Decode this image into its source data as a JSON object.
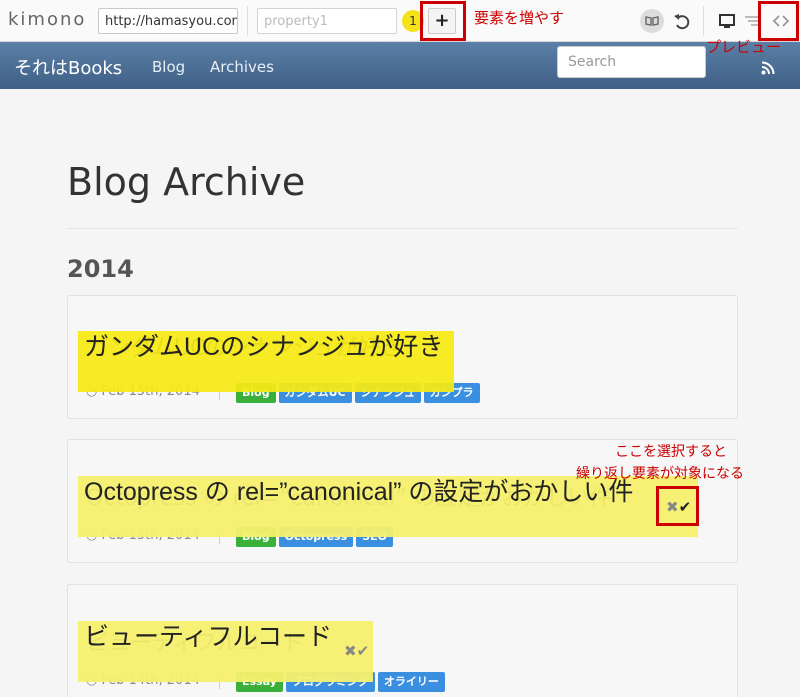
{
  "kimono": {
    "logo": "kimono",
    "url": "http://hamasyou.com/",
    "property_placeholder": "property1",
    "selected_count": "1",
    "add_label": "+",
    "annotation_add": "要素を増やす",
    "annotation_preview": "プレビュー",
    "annotation_select_line1": "ここを選択すると",
    "annotation_select_line2": "繰り返し要素が対象になる"
  },
  "blog": {
    "brand": "それはBooks",
    "nav": [
      "Blog",
      "Archives"
    ],
    "search_placeholder": "Search",
    "page_title": "Blog Archive",
    "year": "2014"
  },
  "posts": [
    {
      "title": "ガンダムUCのシナンジュが好き",
      "date": "Feb 15th, 2014",
      "tags": [
        "Blog",
        "ガンダムUC",
        "シナンジュ",
        "ガンプラ"
      ]
    },
    {
      "title": "Octopress の rel=”canonical” の設定がおかしい件",
      "date": "Feb 15th, 2014",
      "tags": [
        "Blog",
        "Octopress",
        "SEO"
      ]
    },
    {
      "title": "ビューティフルコード",
      "date": "Feb 14th, 2014",
      "tags": [
        "Essay",
        "プログラミング",
        "オライリー"
      ]
    }
  ],
  "icons": {
    "reject": "✖",
    "accept": "✔"
  },
  "colors": {
    "highlight": "#f5ea14",
    "annotation_red": "#cc0000",
    "navbar": "#4a6d94",
    "tag_green": "#3ab03a",
    "tag_blue": "#3b8fe0"
  }
}
